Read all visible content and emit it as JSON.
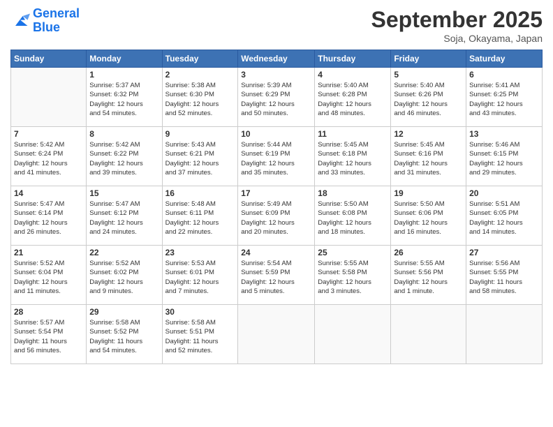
{
  "logo": {
    "text_general": "General",
    "text_blue": "Blue"
  },
  "header": {
    "month_title": "September 2025",
    "location": "Soja, Okayama, Japan"
  },
  "days_of_week": [
    "Sunday",
    "Monday",
    "Tuesday",
    "Wednesday",
    "Thursday",
    "Friday",
    "Saturday"
  ],
  "weeks": [
    [
      {
        "day": "",
        "info": ""
      },
      {
        "day": "1",
        "info": "Sunrise: 5:37 AM\nSunset: 6:32 PM\nDaylight: 12 hours\nand 54 minutes."
      },
      {
        "day": "2",
        "info": "Sunrise: 5:38 AM\nSunset: 6:30 PM\nDaylight: 12 hours\nand 52 minutes."
      },
      {
        "day": "3",
        "info": "Sunrise: 5:39 AM\nSunset: 6:29 PM\nDaylight: 12 hours\nand 50 minutes."
      },
      {
        "day": "4",
        "info": "Sunrise: 5:40 AM\nSunset: 6:28 PM\nDaylight: 12 hours\nand 48 minutes."
      },
      {
        "day": "5",
        "info": "Sunrise: 5:40 AM\nSunset: 6:26 PM\nDaylight: 12 hours\nand 46 minutes."
      },
      {
        "day": "6",
        "info": "Sunrise: 5:41 AM\nSunset: 6:25 PM\nDaylight: 12 hours\nand 43 minutes."
      }
    ],
    [
      {
        "day": "7",
        "info": "Sunrise: 5:42 AM\nSunset: 6:24 PM\nDaylight: 12 hours\nand 41 minutes."
      },
      {
        "day": "8",
        "info": "Sunrise: 5:42 AM\nSunset: 6:22 PM\nDaylight: 12 hours\nand 39 minutes."
      },
      {
        "day": "9",
        "info": "Sunrise: 5:43 AM\nSunset: 6:21 PM\nDaylight: 12 hours\nand 37 minutes."
      },
      {
        "day": "10",
        "info": "Sunrise: 5:44 AM\nSunset: 6:19 PM\nDaylight: 12 hours\nand 35 minutes."
      },
      {
        "day": "11",
        "info": "Sunrise: 5:45 AM\nSunset: 6:18 PM\nDaylight: 12 hours\nand 33 minutes."
      },
      {
        "day": "12",
        "info": "Sunrise: 5:45 AM\nSunset: 6:16 PM\nDaylight: 12 hours\nand 31 minutes."
      },
      {
        "day": "13",
        "info": "Sunrise: 5:46 AM\nSunset: 6:15 PM\nDaylight: 12 hours\nand 29 minutes."
      }
    ],
    [
      {
        "day": "14",
        "info": "Sunrise: 5:47 AM\nSunset: 6:14 PM\nDaylight: 12 hours\nand 26 minutes."
      },
      {
        "day": "15",
        "info": "Sunrise: 5:47 AM\nSunset: 6:12 PM\nDaylight: 12 hours\nand 24 minutes."
      },
      {
        "day": "16",
        "info": "Sunrise: 5:48 AM\nSunset: 6:11 PM\nDaylight: 12 hours\nand 22 minutes."
      },
      {
        "day": "17",
        "info": "Sunrise: 5:49 AM\nSunset: 6:09 PM\nDaylight: 12 hours\nand 20 minutes."
      },
      {
        "day": "18",
        "info": "Sunrise: 5:50 AM\nSunset: 6:08 PM\nDaylight: 12 hours\nand 18 minutes."
      },
      {
        "day": "19",
        "info": "Sunrise: 5:50 AM\nSunset: 6:06 PM\nDaylight: 12 hours\nand 16 minutes."
      },
      {
        "day": "20",
        "info": "Sunrise: 5:51 AM\nSunset: 6:05 PM\nDaylight: 12 hours\nand 14 minutes."
      }
    ],
    [
      {
        "day": "21",
        "info": "Sunrise: 5:52 AM\nSunset: 6:04 PM\nDaylight: 12 hours\nand 11 minutes."
      },
      {
        "day": "22",
        "info": "Sunrise: 5:52 AM\nSunset: 6:02 PM\nDaylight: 12 hours\nand 9 minutes."
      },
      {
        "day": "23",
        "info": "Sunrise: 5:53 AM\nSunset: 6:01 PM\nDaylight: 12 hours\nand 7 minutes."
      },
      {
        "day": "24",
        "info": "Sunrise: 5:54 AM\nSunset: 5:59 PM\nDaylight: 12 hours\nand 5 minutes."
      },
      {
        "day": "25",
        "info": "Sunrise: 5:55 AM\nSunset: 5:58 PM\nDaylight: 12 hours\nand 3 minutes."
      },
      {
        "day": "26",
        "info": "Sunrise: 5:55 AM\nSunset: 5:56 PM\nDaylight: 12 hours\nand 1 minute."
      },
      {
        "day": "27",
        "info": "Sunrise: 5:56 AM\nSunset: 5:55 PM\nDaylight: 11 hours\nand 58 minutes."
      }
    ],
    [
      {
        "day": "28",
        "info": "Sunrise: 5:57 AM\nSunset: 5:54 PM\nDaylight: 11 hours\nand 56 minutes."
      },
      {
        "day": "29",
        "info": "Sunrise: 5:58 AM\nSunset: 5:52 PM\nDaylight: 11 hours\nand 54 minutes."
      },
      {
        "day": "30",
        "info": "Sunrise: 5:58 AM\nSunset: 5:51 PM\nDaylight: 11 hours\nand 52 minutes."
      },
      {
        "day": "",
        "info": ""
      },
      {
        "day": "",
        "info": ""
      },
      {
        "day": "",
        "info": ""
      },
      {
        "day": "",
        "info": ""
      }
    ]
  ]
}
